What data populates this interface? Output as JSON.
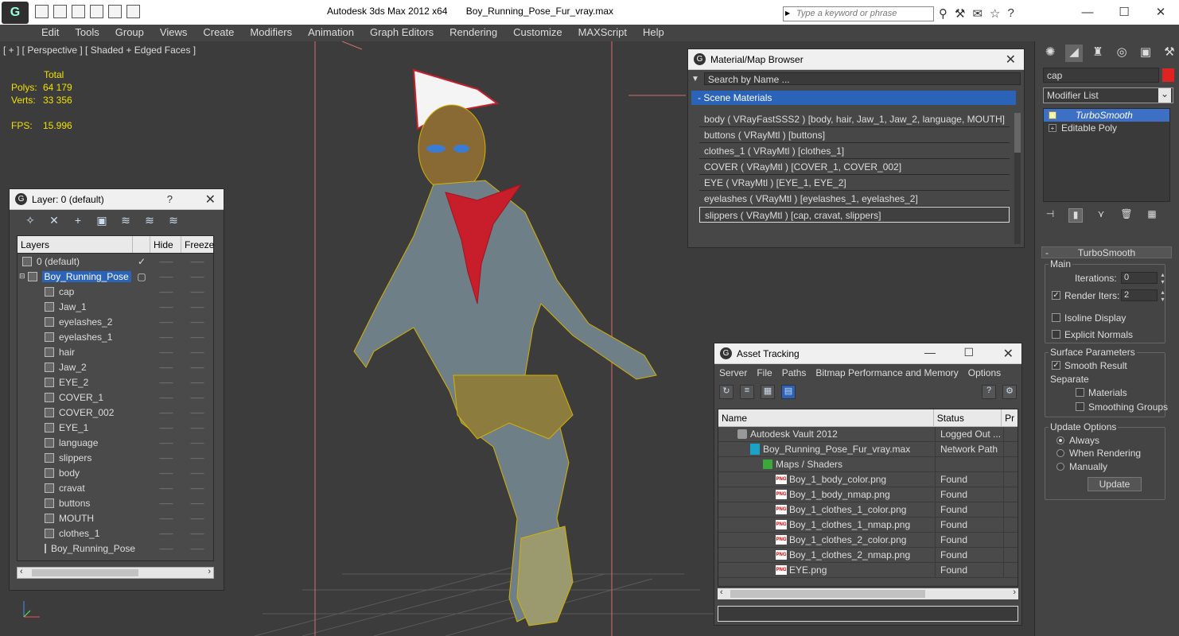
{
  "window": {
    "app_title": "Autodesk 3ds Max  2012 x64",
    "file_name": "Boy_Running_Pose_Fur_vray.max",
    "search_placeholder": "Type a keyword or phrase"
  },
  "menu": [
    "Edit",
    "Tools",
    "Group",
    "Views",
    "Create",
    "Modifiers",
    "Animation",
    "Graph Editors",
    "Rendering",
    "Customize",
    "MAXScript",
    "Help"
  ],
  "viewport": {
    "label": "[ + ] [ Perspective ] [ Shaded + Edged Faces ]",
    "stats_header": "Total",
    "polys_label": "Polys:",
    "polys_value": "64 179",
    "verts_label": "Verts:",
    "verts_value": "33 356",
    "fps_label": "FPS:",
    "fps_value": "15.996"
  },
  "layer_panel": {
    "title": "Layer: 0 (default)",
    "help": "?",
    "columns": [
      "Layers",
      "Hide",
      "Freeze"
    ],
    "rows": [
      {
        "name": "0 (default)",
        "type": "layer",
        "check": "✓",
        "selected": false
      },
      {
        "name": "Boy_Running_Pose",
        "type": "layer-expanded",
        "check": "▢",
        "selected": true
      },
      {
        "name": "cap",
        "type": "object"
      },
      {
        "name": "Jaw_1",
        "type": "object"
      },
      {
        "name": "eyelashes_2",
        "type": "object"
      },
      {
        "name": "eyelashes_1",
        "type": "object"
      },
      {
        "name": "hair",
        "type": "object"
      },
      {
        "name": "Jaw_2",
        "type": "object"
      },
      {
        "name": "EYE_2",
        "type": "object"
      },
      {
        "name": "COVER_1",
        "type": "object"
      },
      {
        "name": "COVER_002",
        "type": "object"
      },
      {
        "name": "EYE_1",
        "type": "object"
      },
      {
        "name": "language",
        "type": "object"
      },
      {
        "name": "slippers",
        "type": "object"
      },
      {
        "name": "body",
        "type": "object"
      },
      {
        "name": "cravat",
        "type": "object"
      },
      {
        "name": "buttons",
        "type": "object"
      },
      {
        "name": "MOUTH",
        "type": "object"
      },
      {
        "name": "clothes_1",
        "type": "object"
      },
      {
        "name": "Boy_Running_Pose",
        "type": "object"
      }
    ]
  },
  "material_browser": {
    "title": "Material/Map Browser",
    "search_placeholder": "Search by Name ...",
    "group": "- Scene Materials",
    "materials": [
      "body  ( VRayFastSSS2 )  [body, hair, Jaw_1, Jaw_2, language, MOUTH]",
      "buttons  ( VRayMtl )  [buttons]",
      "clothes_1  ( VRayMtl )  [clothes_1]",
      "COVER  ( VRayMtl )  [COVER_1, COVER_002]",
      "EYE  ( VRayMtl )  [EYE_1, EYE_2]",
      "eyelashes  ( VRayMtl )  [eyelashes_1, eyelashes_2]",
      "slippers  ( VRayMtl )  [cap, cravat, slippers]"
    ],
    "selected_index": 6
  },
  "asset_tracking": {
    "title": "Asset Tracking",
    "menu": [
      "Server",
      "File",
      "Paths",
      "Bitmap Performance and Memory",
      "Options"
    ],
    "columns": [
      "Name",
      "Status",
      "Pr"
    ],
    "rows": [
      {
        "name": "Autodesk Vault 2012",
        "status": "Logged Out ...",
        "indent": 1,
        "icon": "vault-icon"
      },
      {
        "name": "Boy_Running_Pose_Fur_vray.max",
        "status": "Network Path",
        "indent": 2,
        "icon": "max-file-icon"
      },
      {
        "name": "Maps / Shaders",
        "status": "",
        "indent": 3,
        "icon": "maps-icon"
      },
      {
        "name": "Boy_1_body_color.png",
        "status": "Found",
        "indent": 4,
        "icon": "png-icon"
      },
      {
        "name": "Boy_1_body_nmap.png",
        "status": "Found",
        "indent": 4,
        "icon": "png-icon"
      },
      {
        "name": "Boy_1_clothes_1_color.png",
        "status": "Found",
        "indent": 4,
        "icon": "png-icon"
      },
      {
        "name": "Boy_1_clothes_1_nmap.png",
        "status": "Found",
        "indent": 4,
        "icon": "png-icon"
      },
      {
        "name": "Boy_1_clothes_2_color.png",
        "status": "Found",
        "indent": 4,
        "icon": "png-icon"
      },
      {
        "name": "Boy_1_clothes_2_nmap.png",
        "status": "Found",
        "indent": 4,
        "icon": "png-icon"
      },
      {
        "name": "EYE.png",
        "status": "Found",
        "indent": 4,
        "icon": "png-icon"
      }
    ],
    "png_badge": "PNG"
  },
  "command_panel": {
    "object_name": "cap",
    "object_color": "#e02222",
    "modifier_list": "Modifier List",
    "stack": [
      {
        "name": "TurboSmooth",
        "selected": true
      },
      {
        "name": "Editable Poly",
        "selected": false
      }
    ],
    "rollout": "TurboSmooth",
    "main_label": "Main",
    "iterations_label": "Iterations:",
    "iterations_value": "0",
    "render_iters_label": "Render Iters:",
    "render_iters_value": "2",
    "isoline_label": "Isoline Display",
    "explicit_normals_label": "Explicit Normals",
    "surface_params_label": "Surface Parameters",
    "smooth_result_label": "Smooth Result",
    "separate_label": "Separate",
    "materials_label": "Materials",
    "smoothing_groups_label": "Smoothing Groups",
    "update_options_label": "Update Options",
    "always_label": "Always",
    "when_rendering_label": "When Rendering",
    "manually_label": "Manually",
    "update_button": "Update"
  },
  "colors": {
    "accent": "#2a63b8",
    "stats": "#f0e000",
    "wire": "#d4b000"
  }
}
